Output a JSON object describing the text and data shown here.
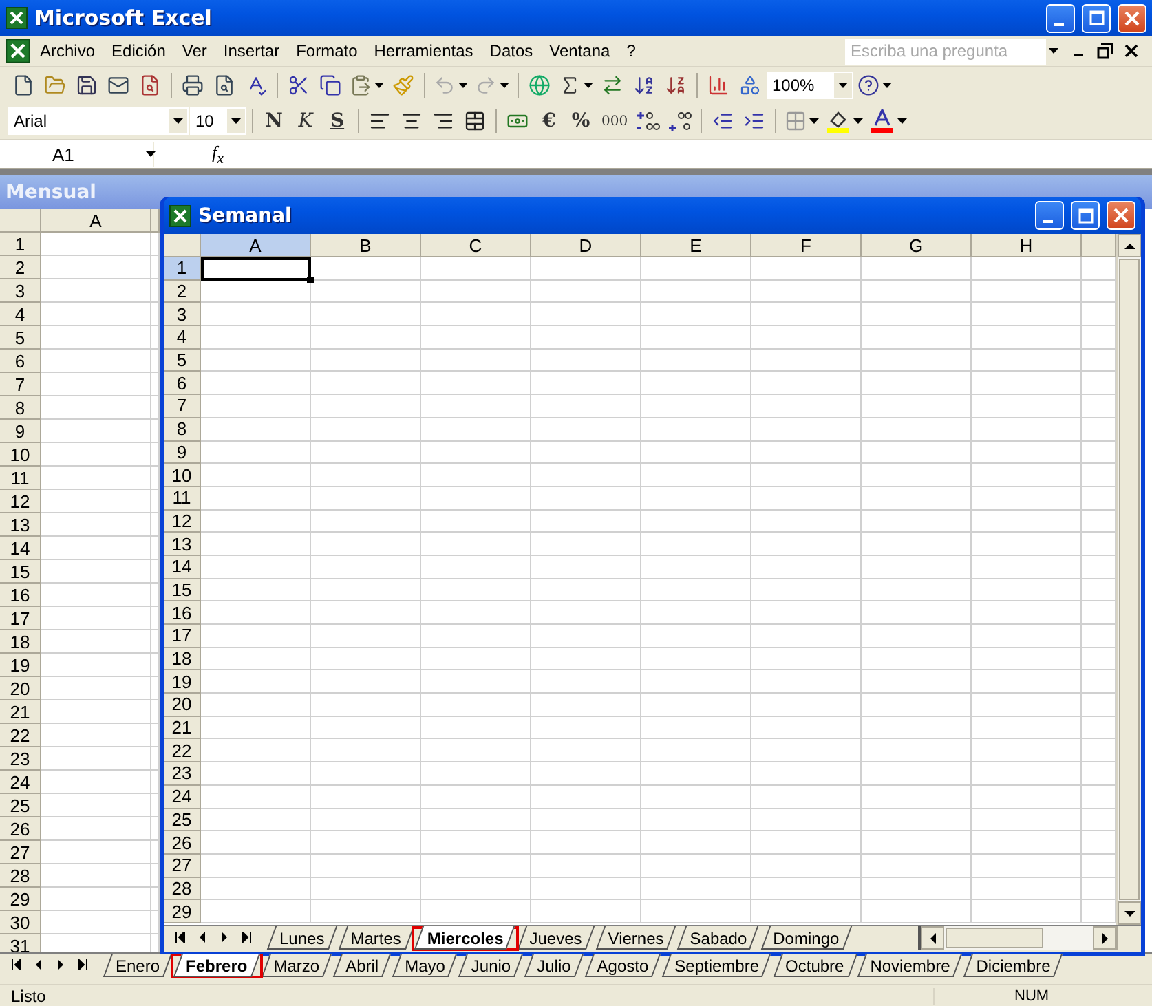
{
  "window": {
    "title": "Microsoft Excel"
  },
  "menu": [
    "Archivo",
    "Edición",
    "Ver",
    "Insertar",
    "Formato",
    "Herramientas",
    "Datos",
    "Ventana",
    "?"
  ],
  "help_box": {
    "placeholder": "Escriba una pregunta"
  },
  "standard_toolbar": {
    "zoom": "100%"
  },
  "format_toolbar": {
    "font": "Arial",
    "size": "10",
    "bold": "N",
    "italic": "K",
    "underline": "S",
    "euro": "€",
    "percent": "%",
    "thousands": "000"
  },
  "formula_bar": {
    "name_box": "A1",
    "function_label": "f$_{x}$"
  },
  "mensual": {
    "title": "Mensual",
    "active": false,
    "columns": [
      {
        "label": "A",
        "selected": false
      }
    ],
    "rows": [
      {
        "label": "1",
        "selected": false
      },
      {
        "label": "2",
        "selected": false
      },
      {
        "label": "3",
        "selected": false
      },
      {
        "label": "4",
        "selected": false
      },
      {
        "label": "5",
        "selected": false
      },
      {
        "label": "6",
        "selected": false
      },
      {
        "label": "7",
        "selected": false
      },
      {
        "label": "8",
        "selected": false
      },
      {
        "label": "9",
        "selected": false
      },
      {
        "label": "10",
        "selected": false
      },
      {
        "label": "11",
        "selected": false
      },
      {
        "label": "12",
        "selected": false
      },
      {
        "label": "13",
        "selected": false
      },
      {
        "label": "14",
        "selected": false
      },
      {
        "label": "15",
        "selected": false
      },
      {
        "label": "16",
        "selected": false
      },
      {
        "label": "17",
        "selected": false
      },
      {
        "label": "18",
        "selected": false
      },
      {
        "label": "19",
        "selected": false
      },
      {
        "label": "20",
        "selected": false
      },
      {
        "label": "21",
        "selected": false
      },
      {
        "label": "22",
        "selected": false
      },
      {
        "label": "23",
        "selected": false
      },
      {
        "label": "24",
        "selected": false
      },
      {
        "label": "25",
        "selected": false
      },
      {
        "label": "26",
        "selected": false
      },
      {
        "label": "27",
        "selected": false
      },
      {
        "label": "28",
        "selected": false
      },
      {
        "label": "29",
        "selected": false
      },
      {
        "label": "30",
        "selected": false
      },
      {
        "label": "31",
        "selected": false
      }
    ],
    "sheet_tabs": [
      {
        "label": "Enero",
        "selected": false
      },
      {
        "label": "Febrero",
        "selected": true
      },
      {
        "label": "Marzo",
        "selected": false
      },
      {
        "label": "Abril",
        "selected": false
      },
      {
        "label": "Mayo",
        "selected": false
      },
      {
        "label": "Junio",
        "selected": false
      },
      {
        "label": "Julio",
        "selected": false
      },
      {
        "label": "Agosto",
        "selected": false
      },
      {
        "label": "Septiembre",
        "selected": false
      },
      {
        "label": "Octubre",
        "selected": false
      },
      {
        "label": "Noviembre",
        "selected": false
      },
      {
        "label": "Diciembre",
        "selected": false
      }
    ]
  },
  "semanal": {
    "title": "Semanal",
    "active": true,
    "columns": [
      {
        "label": "A",
        "selected": true
      },
      {
        "label": "B",
        "selected": false
      },
      {
        "label": "C",
        "selected": false
      },
      {
        "label": "D",
        "selected": false
      },
      {
        "label": "E",
        "selected": false
      },
      {
        "label": "F",
        "selected": false
      },
      {
        "label": "G",
        "selected": false
      },
      {
        "label": "H",
        "selected": false
      }
    ],
    "rows": [
      {
        "label": "1",
        "selected": true
      },
      {
        "label": "2",
        "selected": false
      },
      {
        "label": "3",
        "selected": false
      },
      {
        "label": "4",
        "selected": false
      },
      {
        "label": "5",
        "selected": false
      },
      {
        "label": "6",
        "selected": false
      },
      {
        "label": "7",
        "selected": false
      },
      {
        "label": "8",
        "selected": false
      },
      {
        "label": "9",
        "selected": false
      },
      {
        "label": "10",
        "selected": false
      },
      {
        "label": "11",
        "selected": false
      },
      {
        "label": "12",
        "selected": false
      },
      {
        "label": "13",
        "selected": false
      },
      {
        "label": "14",
        "selected": false
      },
      {
        "label": "15",
        "selected": false
      },
      {
        "label": "16",
        "selected": false
      },
      {
        "label": "17",
        "selected": false
      },
      {
        "label": "18",
        "selected": false
      },
      {
        "label": "19",
        "selected": false
      },
      {
        "label": "20",
        "selected": false
      },
      {
        "label": "21",
        "selected": false
      },
      {
        "label": "22",
        "selected": false
      },
      {
        "label": "23",
        "selected": false
      },
      {
        "label": "24",
        "selected": false
      },
      {
        "label": "25",
        "selected": false
      },
      {
        "label": "26",
        "selected": false
      },
      {
        "label": "27",
        "selected": false
      },
      {
        "label": "28",
        "selected": false
      },
      {
        "label": "29",
        "selected": false
      }
    ],
    "sheet_tabs": [
      {
        "label": "Lunes",
        "selected": false
      },
      {
        "label": "Martes",
        "selected": false
      },
      {
        "label": "Miercoles",
        "selected": true
      },
      {
        "label": "Jueves",
        "selected": false
      },
      {
        "label": "Viernes",
        "selected": false
      },
      {
        "label": "Sabado",
        "selected": false
      },
      {
        "label": "Domingo",
        "selected": false
      }
    ]
  },
  "status_bar": {
    "text": "Listo",
    "indicators": [
      "NUM"
    ]
  }
}
